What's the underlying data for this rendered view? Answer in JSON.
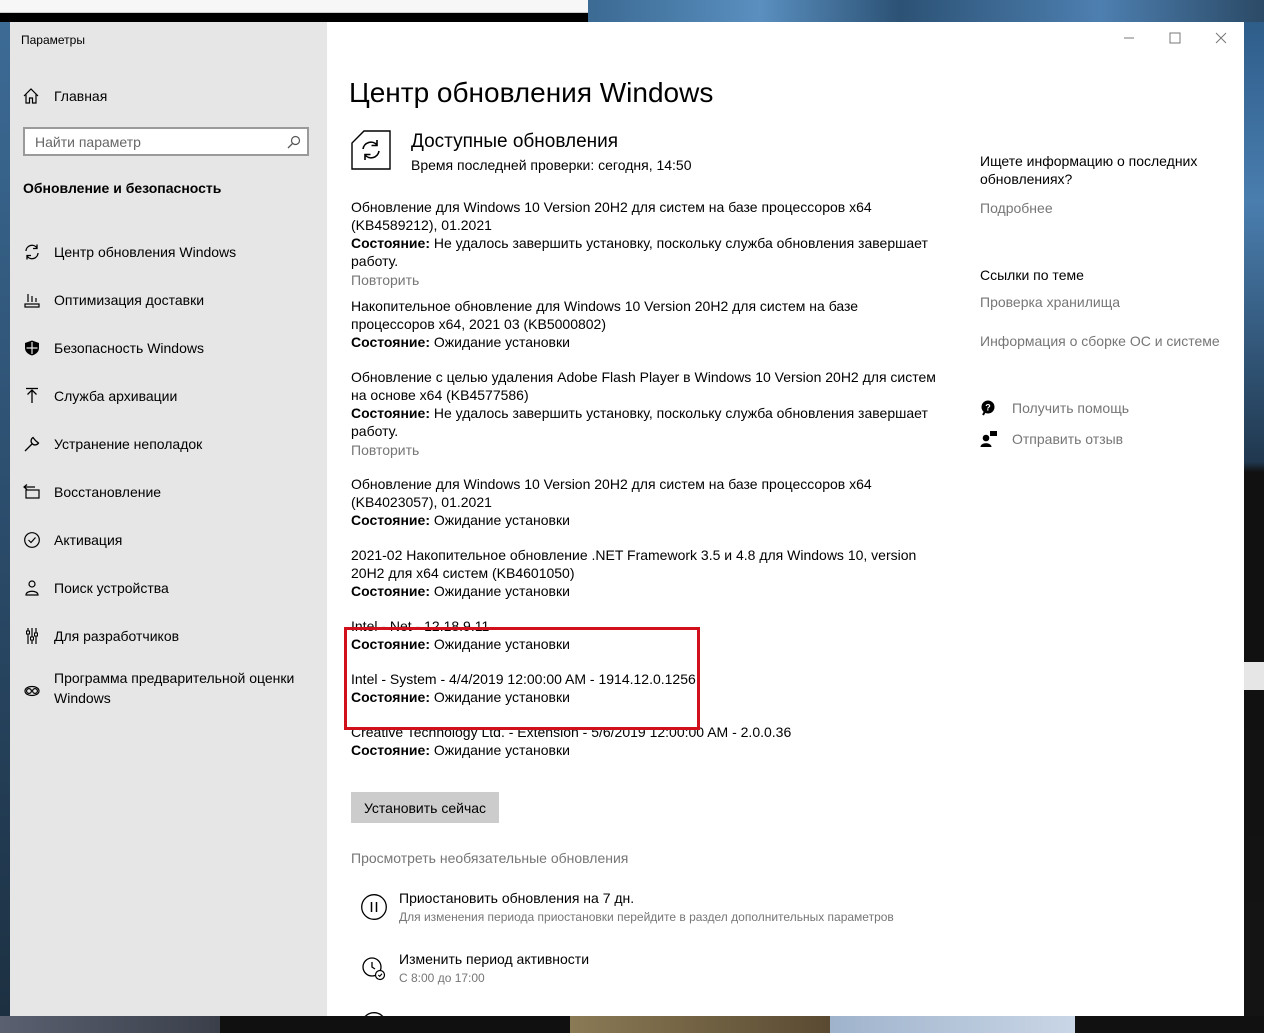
{
  "window": {
    "title": "Параметры",
    "controls": {
      "minimize": "—",
      "maximize": "☐",
      "close": "✕"
    }
  },
  "sidebar": {
    "home_label": "Главная",
    "search_placeholder": "Найти параметр",
    "section_title": "Обновление и безопасность",
    "items": [
      {
        "label": "Центр обновления Windows",
        "icon": "sync-icon"
      },
      {
        "label": "Оптимизация доставки",
        "icon": "delivery-icon"
      },
      {
        "label": "Безопасность Windows",
        "icon": "shield-icon"
      },
      {
        "label": "Служба архивации",
        "icon": "backup-icon"
      },
      {
        "label": "Устранение неполадок",
        "icon": "wrench-icon"
      },
      {
        "label": "Восстановление",
        "icon": "recovery-icon"
      },
      {
        "label": "Активация",
        "icon": "check-circle-icon"
      },
      {
        "label": "Поиск устройства",
        "icon": "person-location-icon"
      },
      {
        "label": "Для разработчиков",
        "icon": "developer-icon"
      },
      {
        "label": "Программа предварительной оценки Windows",
        "icon": "insider-icon"
      }
    ]
  },
  "main": {
    "title": "Центр обновления Windows",
    "status": {
      "heading": "Доступные обновления",
      "last_check": "Время последней проверки: сегодня, 14:50"
    },
    "state_label": "Состояние:",
    "updates": [
      {
        "name": "Обновление для Windows 10 Version 20H2 для систем на базе процессоров x64 (KB4589212), 01.2021",
        "state": "Не удалось завершить установку, поскольку служба обновления завершает работу.",
        "retry": "Повторить"
      },
      {
        "name": "Накопительное обновление для Windows 10 Version 20H2 для систем на базе процессоров x64, 2021 03 (KB5000802)",
        "state": "Ожидание установки"
      },
      {
        "name": "Обновление с целью удаления Adobe Flash Player в Windows 10 Version 20H2 для систем на основе x64 (KB4577586)",
        "state": "Не удалось завершить установку, поскольку служба обновления завершает работу.",
        "retry": "Повторить"
      },
      {
        "name": "Обновление для Windows 10 Version 20H2 для систем на базе процессоров x64 (KB4023057), 01.2021",
        "state": "Ожидание установки"
      },
      {
        "name": "2021-02 Накопительное обновление .NET Framework 3.5 и 4.8 для Windows 10, version 20H2 для x64 систем (KB4601050)",
        "state": "Ожидание установки"
      },
      {
        "name": "Intel - Net - 12.18.9.11",
        "state": "Ожидание установки"
      },
      {
        "name": "Intel - System - 4/4/2019 12:00:00 AM - 1914.12.0.1256",
        "state": "Ожидание установки"
      },
      {
        "name": "Creative Technology Ltd. - Extension - 5/6/2019 12:00:00 AM - 2.0.0.36",
        "state": "Ожидание установки"
      }
    ],
    "install_button": "Установить сейчас",
    "optional_link": "Просмотреть необязательные обновления",
    "pause": {
      "title": "Приостановить обновления на 7 дн.",
      "desc": "Для изменения периода приостановки перейдите в раздел дополнительных параметров"
    },
    "active_hours": {
      "title": "Изменить период активности",
      "desc": "С 8:00 до 17:00"
    }
  },
  "right": {
    "question": "Ищете информацию о последних обновлениях?",
    "more_link": "Подробнее",
    "related_title": "Ссылки по теме",
    "related_links": [
      "Проверка хранилища",
      "Информация о сборке ОС и системе"
    ],
    "get_help": "Получить помощь",
    "feedback": "Отправить отзыв"
  },
  "colors": {
    "accent": "#0078d4",
    "highlight_box": "#d0101b",
    "link_gray": "#767676",
    "sidebar_bg": "#e6e6e6"
  }
}
